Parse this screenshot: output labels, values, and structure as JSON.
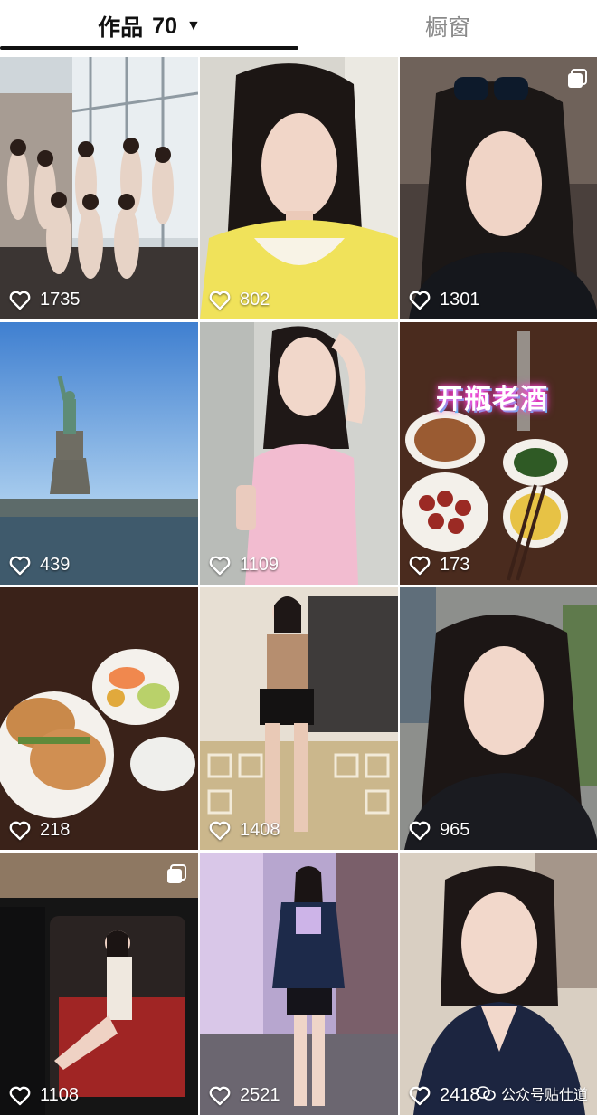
{
  "tabs": {
    "works_label": "作品",
    "works_count": "70",
    "window_label": "橱窗"
  },
  "tiles": [
    {
      "likes": "1735",
      "multi": false
    },
    {
      "likes": "802",
      "multi": false
    },
    {
      "likes": "1301",
      "multi": true
    },
    {
      "likes": "439",
      "multi": false
    },
    {
      "likes": "1109",
      "multi": false
    },
    {
      "likes": "173",
      "multi": false,
      "overlay_text": "开瓶老酒"
    },
    {
      "likes": "218",
      "multi": false
    },
    {
      "likes": "1408",
      "multi": false
    },
    {
      "likes": "965",
      "multi": false
    },
    {
      "likes": "1108",
      "multi": true
    },
    {
      "likes": "2521",
      "multi": false
    },
    {
      "likes": "2418",
      "multi": false
    }
  ],
  "watermark": {
    "text": "公众号贴仕道"
  },
  "colors": {
    "accent": "#111111",
    "inactive": "#8a8a8a"
  }
}
